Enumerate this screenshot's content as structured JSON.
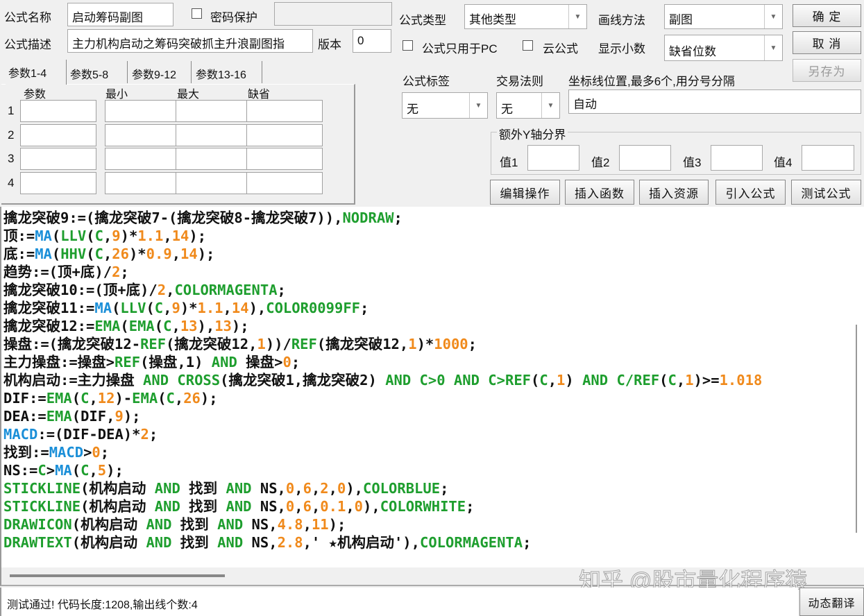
{
  "form": {
    "name_label": "公式名称",
    "name_value": "启动筹码副图",
    "password_label": "密码保护",
    "desc_label": "公式描述",
    "desc_value": "主力机构启动之筹码突破抓主升浪副图指",
    "version_label": "版本",
    "version_value": "0",
    "type_label": "公式类型",
    "type_value": "其他类型",
    "draw_label": "画线方法",
    "draw_value": "副图",
    "pc_only_label": "公式只用于PC",
    "cloud_label": "云公式",
    "decimal_label": "显示小数",
    "decimal_value": "缺省位数",
    "tag_label": "公式标签",
    "tag_value": "无",
    "rule_label": "交易法则",
    "rule_value": "无",
    "axis_label": "坐标线位置,最多6个,用分号分隔",
    "axis_value": "自动",
    "yaxis_group": "额外Y轴分界",
    "y_values": [
      "值1",
      "值2",
      "值3",
      "值4"
    ]
  },
  "buttons": {
    "ok": "确 定",
    "cancel": "取 消",
    "save_as": "另存为",
    "edit": "编辑操作",
    "insert_func": "插入函数",
    "insert_res": "插入资源",
    "import": "引入公式",
    "test": "测试公式",
    "translate": "动态翻译"
  },
  "tabs": [
    "参数1-4",
    "参数5-8",
    "参数9-12",
    "参数13-16"
  ],
  "param_headers": [
    "参数",
    "最小",
    "最大",
    "缺省"
  ],
  "param_rows": [
    "1",
    "2",
    "3",
    "4"
  ],
  "code_lines": [
    [
      [
        "k",
        "擒龙突破9:=(擒龙突破7-(擒龙突破8-擒龙突破7)),"
      ],
      [
        "g",
        "NODRAW"
      ],
      [
        "k",
        ";"
      ]
    ],
    [
      [
        "k",
        "顶:="
      ],
      [
        "b",
        "MA"
      ],
      [
        "k",
        "("
      ],
      [
        "g",
        "LLV"
      ],
      [
        "k",
        "("
      ],
      [
        "g",
        "C"
      ],
      [
        "k",
        ","
      ],
      [
        "o",
        "9"
      ],
      [
        "k",
        ")*"
      ],
      [
        "o",
        "1.1"
      ],
      [
        "k",
        ","
      ],
      [
        "o",
        "14"
      ],
      [
        "k",
        ");"
      ]
    ],
    [
      [
        "k",
        "底:="
      ],
      [
        "b",
        "MA"
      ],
      [
        "k",
        "("
      ],
      [
        "g",
        "HHV"
      ],
      [
        "k",
        "("
      ],
      [
        "g",
        "C"
      ],
      [
        "k",
        ","
      ],
      [
        "o",
        "26"
      ],
      [
        "k",
        ")*"
      ],
      [
        "o",
        "0.9"
      ],
      [
        "k",
        ","
      ],
      [
        "o",
        "14"
      ],
      [
        "k",
        ");"
      ]
    ],
    [
      [
        "k",
        "趋势:=(顶+底)/"
      ],
      [
        "o",
        "2"
      ],
      [
        "k",
        ";"
      ]
    ],
    [
      [
        "k",
        "擒龙突破10:=(顶+底)/"
      ],
      [
        "o",
        "2"
      ],
      [
        "k",
        ","
      ],
      [
        "g",
        "COLORMAGENTA"
      ],
      [
        "k",
        ";"
      ]
    ],
    [
      [
        "k",
        "擒龙突破11:="
      ],
      [
        "b",
        "MA"
      ],
      [
        "k",
        "("
      ],
      [
        "g",
        "LLV"
      ],
      [
        "k",
        "("
      ],
      [
        "g",
        "C"
      ],
      [
        "k",
        ","
      ],
      [
        "o",
        "9"
      ],
      [
        "k",
        ")*"
      ],
      [
        "o",
        "1.1"
      ],
      [
        "k",
        ","
      ],
      [
        "o",
        "14"
      ],
      [
        "k",
        "),"
      ],
      [
        "g",
        "COLOR0099FF"
      ],
      [
        "k",
        ";"
      ]
    ],
    [
      [
        "k",
        "擒龙突破12:="
      ],
      [
        "g",
        "EMA"
      ],
      [
        "k",
        "("
      ],
      [
        "g",
        "EMA"
      ],
      [
        "k",
        "("
      ],
      [
        "g",
        "C"
      ],
      [
        "k",
        ","
      ],
      [
        "o",
        "13"
      ],
      [
        "k",
        "),"
      ],
      [
        "o",
        "13"
      ],
      [
        "k",
        ");"
      ]
    ],
    [
      [
        "k",
        "操盘:=(擒龙突破12-"
      ],
      [
        "g",
        "REF"
      ],
      [
        "k",
        "(擒龙突破12,"
      ],
      [
        "o",
        "1"
      ],
      [
        "k",
        "))/"
      ],
      [
        "g",
        "REF"
      ],
      [
        "k",
        "(擒龙突破12,"
      ],
      [
        "o",
        "1"
      ],
      [
        "k",
        ")*"
      ],
      [
        "o",
        "1000"
      ],
      [
        "k",
        ";"
      ]
    ],
    [
      [
        "k",
        "主力操盘:=操盘>"
      ],
      [
        "g",
        "REF"
      ],
      [
        "k",
        "(操盘,1) "
      ],
      [
        "g",
        "AND"
      ],
      [
        "k",
        " 操盘>"
      ],
      [
        "o",
        "0"
      ],
      [
        "k",
        ";"
      ]
    ],
    [
      [
        "k",
        "机构启动:=主力操盘 "
      ],
      [
        "g",
        "AND CROSS"
      ],
      [
        "k",
        "(擒龙突破1,擒龙突破2) "
      ],
      [
        "g",
        "AND C>0 AND C>REF"
      ],
      [
        "k",
        "("
      ],
      [
        "g",
        "C"
      ],
      [
        "k",
        ","
      ],
      [
        "o",
        "1"
      ],
      [
        "k",
        ") "
      ],
      [
        "g",
        "AND C/REF"
      ],
      [
        "k",
        "("
      ],
      [
        "g",
        "C"
      ],
      [
        "k",
        ","
      ],
      [
        "o",
        "1"
      ],
      [
        "k",
        ")>="
      ],
      [
        "o",
        "1.018"
      ]
    ],
    [
      [
        "k",
        "DIF:="
      ],
      [
        "g",
        "EMA"
      ],
      [
        "k",
        "("
      ],
      [
        "g",
        "C"
      ],
      [
        "k",
        ","
      ],
      [
        "o",
        "12"
      ],
      [
        "k",
        ")-"
      ],
      [
        "g",
        "EMA"
      ],
      [
        "k",
        "("
      ],
      [
        "g",
        "C"
      ],
      [
        "k",
        ","
      ],
      [
        "o",
        "26"
      ],
      [
        "k",
        ");"
      ]
    ],
    [
      [
        "k",
        "DEA:="
      ],
      [
        "g",
        "EMA"
      ],
      [
        "k",
        "(DIF,"
      ],
      [
        "o",
        "9"
      ],
      [
        "k",
        ");"
      ]
    ],
    [
      [
        "b",
        "MACD"
      ],
      [
        "k",
        ":=(DIF-DEA)*"
      ],
      [
        "o",
        "2"
      ],
      [
        "k",
        ";"
      ]
    ],
    [
      [
        "k",
        "找到:="
      ],
      [
        "b",
        "MACD"
      ],
      [
        "k",
        ">"
      ],
      [
        "o",
        "0"
      ],
      [
        "k",
        ";"
      ]
    ],
    [
      [
        "k",
        "NS:="
      ],
      [
        "g",
        "C"
      ],
      [
        "k",
        ">"
      ],
      [
        "b",
        "MA"
      ],
      [
        "k",
        "("
      ],
      [
        "g",
        "C"
      ],
      [
        "k",
        ","
      ],
      [
        "o",
        "5"
      ],
      [
        "k",
        ");"
      ]
    ],
    [
      [
        "g",
        "STICKLINE"
      ],
      [
        "k",
        "(机构启动 "
      ],
      [
        "g",
        "AND"
      ],
      [
        "k",
        " 找到 "
      ],
      [
        "g",
        "AND"
      ],
      [
        "k",
        " NS,"
      ],
      [
        "o",
        "0"
      ],
      [
        "k",
        ","
      ],
      [
        "o",
        "6"
      ],
      [
        "k",
        ","
      ],
      [
        "o",
        "2"
      ],
      [
        "k",
        ","
      ],
      [
        "o",
        "0"
      ],
      [
        "k",
        "),"
      ],
      [
        "g",
        "COLORBLUE"
      ],
      [
        "k",
        ";"
      ]
    ],
    [
      [
        "g",
        "STICKLINE"
      ],
      [
        "k",
        "(机构启动 "
      ],
      [
        "g",
        "AND"
      ],
      [
        "k",
        " 找到 "
      ],
      [
        "g",
        "AND"
      ],
      [
        "k",
        " NS,"
      ],
      [
        "o",
        "0"
      ],
      [
        "k",
        ","
      ],
      [
        "o",
        "6"
      ],
      [
        "k",
        ","
      ],
      [
        "o",
        "0.1"
      ],
      [
        "k",
        ","
      ],
      [
        "o",
        "0"
      ],
      [
        "k",
        "),"
      ],
      [
        "g",
        "COLORWHITE"
      ],
      [
        "k",
        ";"
      ]
    ],
    [
      [
        "g",
        "DRAWICON"
      ],
      [
        "k",
        "(机构启动 "
      ],
      [
        "g",
        "AND"
      ],
      [
        "k",
        " 找到 "
      ],
      [
        "g",
        "AND"
      ],
      [
        "k",
        " NS,"
      ],
      [
        "o",
        "4.8"
      ],
      [
        "k",
        ","
      ],
      [
        "o",
        "11"
      ],
      [
        "k",
        ");"
      ]
    ],
    [
      [
        "g",
        "DRAWTEXT"
      ],
      [
        "k",
        "(机构启动 "
      ],
      [
        "g",
        "AND"
      ],
      [
        "k",
        " 找到 "
      ],
      [
        "g",
        "AND"
      ],
      [
        "k",
        " NS,"
      ],
      [
        "o",
        "2.8"
      ],
      [
        "k",
        ",' ★机构启动'),"
      ],
      [
        "g",
        "COLORMAGENTA"
      ],
      [
        "k",
        ";"
      ]
    ]
  ],
  "status": "测试通过! 代码长度:1208,输出线个数:4",
  "watermark": "知乎 @股市量化程序猿",
  "colors": {
    "keyword": "#1e9e2e",
    "func": "#1b8fd8",
    "number": "#f08a1c"
  }
}
